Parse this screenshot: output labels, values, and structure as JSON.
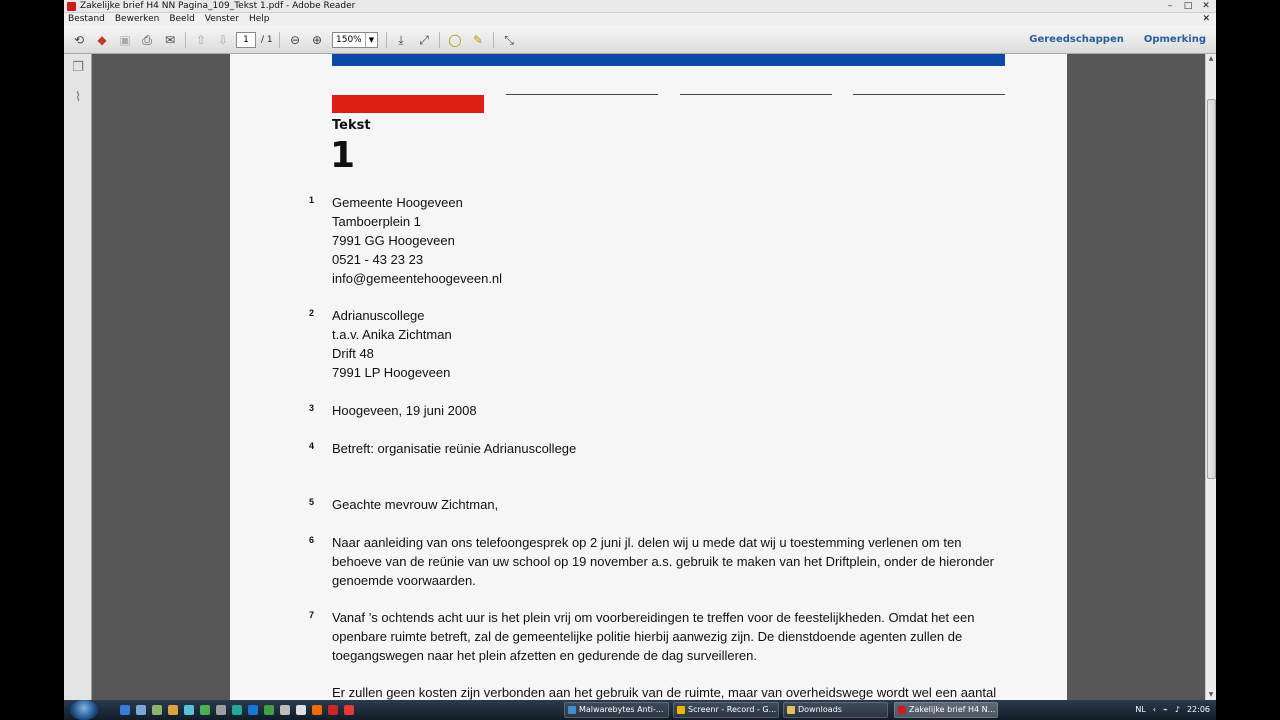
{
  "window": {
    "title": "Zakelijke brief H4 NN Pagina_109_Tekst 1.pdf - Adobe Reader",
    "controls": [
      "–",
      "□",
      "✕"
    ]
  },
  "menu": {
    "items": [
      "Bestand",
      "Bewerken",
      "Beeld",
      "Venster",
      "Help"
    ],
    "close": "✕"
  },
  "toolbar": {
    "page_current": "1",
    "page_total": "/ 1",
    "zoom": "150%",
    "gereedschappen": "Gereedschappen",
    "opmerking": "Opmerking"
  },
  "document": {
    "label": "Tekst",
    "number": "1",
    "sections": [
      {
        "num": "1",
        "lines": [
          "Gemeente Hoogeveen",
          "Tamboerplein 1",
          "7991 GG Hoogeveen",
          "0521 - 43 23 23",
          "info@gemeentehoogeveen.nl"
        ]
      },
      {
        "num": "2",
        "lines": [
          "Adrianuscollege",
          "t.a.v. Anika Zichtman",
          "Drift 48",
          "7991 LP Hoogeveen"
        ]
      },
      {
        "num": "3",
        "lines": [
          "Hoogeveen, 19 juni 2008"
        ]
      },
      {
        "num": "4",
        "lines": [
          "Betreft: organisatie reünie Adrianuscollege"
        ]
      },
      {
        "num": "5",
        "lines": [
          "Geachte mevrouw Zichtman,"
        ]
      },
      {
        "num": "6",
        "lines": [
          "Naar aanleiding van ons telefoongesprek op 2 juni jl. delen wij u mede dat wij u toestemming verlenen om ten",
          "behoeve van de reünie van uw school op 19 november a.s. gebruik te maken van het Driftplein, onder de hieronder",
          "genoemde voorwaarden."
        ]
      },
      {
        "num": "7",
        "lines": [
          "Vanaf ’s ochtends acht uur is het plein vrij om voorbereidingen te treffen voor de feestelijkheden. Omdat het een",
          "openbare ruimte betreft, zal de gemeentelijke politie hierbij aanwezig zijn. De dienstdoende agenten zullen de",
          "toegangswegen naar het plein afzetten en gedurende de dag surveilleren."
        ]
      },
      {
        "num": "",
        "lines": [
          "Er zullen geen kosten zijn verbonden aan het gebruik van de ruimte, maar van overheidswege wordt wel een aantal"
        ]
      }
    ]
  },
  "taskbar": {
    "tasks": [
      "Malwarebytes Anti-...",
      "Screenr - Record - G...",
      "Downloads",
      "Zakelijke brief H4 N..."
    ],
    "lang": "NL",
    "clock": "22:06"
  },
  "colors": {
    "blue_bar": "#0a4aa6",
    "red_bar": "#df1e13",
    "toolbar_link": "#2a5d9f"
  }
}
